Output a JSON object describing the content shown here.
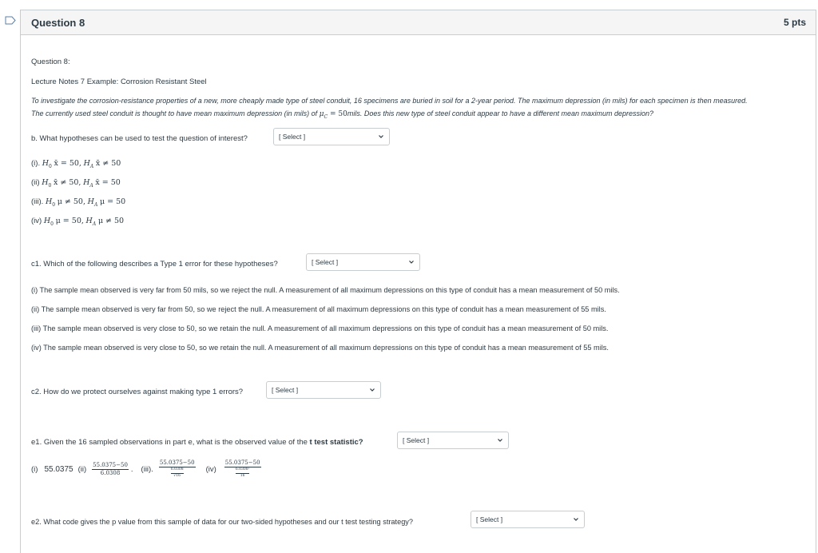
{
  "question": {
    "title": "Question 8",
    "points": "5 pts",
    "label": "Question 8:",
    "subtitle": "Lecture Notes 7 Example: Corrosion Resistant Steel",
    "intro_line1": "To investigate the corrosion-resistance properties of a new, more cheaply made type of steel conduit, 16 specimens are buried in soil for a 2-year period. The maximum depression (in mils) for each specimen is then measured.",
    "intro_line2_pre": "The currently used steel conduit is thought to have mean maximum depression (in mils) of ",
    "intro_math_mu": "μ",
    "intro_math_sub": "C",
    "intro_math_eq": " = 50",
    "intro_line2_post": "mils. Does this new type of steel conduit appear to have a different mean maximum depression?"
  },
  "select_placeholder": "[ Select ]",
  "part_b": {
    "prompt": "b. What hypotheses can be used to test the question of interest?",
    "options": [
      {
        "label": "(i).",
        "h0": "x̄ = 50,",
        "ha": "x̄ ≠ 50"
      },
      {
        "label": "(ii)",
        "h0": "x̄ ≠ 50,",
        "ha": "x̄ = 50"
      },
      {
        "label": "(iii).",
        "h0": "μ ≠ 50,",
        "ha": "μ = 50"
      },
      {
        "label": "(iv)",
        "h0": "μ = 50,",
        "ha": "μ ≠ 50"
      }
    ],
    "h0_symbol": "H",
    "h0_sub": "0",
    "ha_symbol": "H",
    "ha_sub": "A"
  },
  "part_c1": {
    "prompt": "c1. Which of the following describes a Type 1 error for these hypotheses?",
    "options": [
      "(i) The sample mean observed is very far from 50 mils, so we reject the null. A measurement of all maximum depressions on this type of conduit has a mean measurement of 50 mils.",
      "(ii) The sample mean observed is very far from 50, so we reject the null. A measurement of all maximum depressions on this type of conduit has a mean measurement of 55 mils.",
      "(iii) The sample mean observed is very close to 50, so we retain the null. A measurement of all maximum depressions on this type of conduit has a mean measurement of 50 mils.",
      "(iv) The sample mean observed is very close to 50, so we retain the null. A measurement of all maximum depressions on this type of conduit has a mean measurement of 55 mils."
    ]
  },
  "part_c2": {
    "prompt": "c2. How do we protect ourselves against making type 1 errors?"
  },
  "part_e1": {
    "prompt_pre": "e1. Given the 16 sampled observations in part e, what is the observed value of the ",
    "prompt_bold": "t test statistic?",
    "opt_i_label": "(i)",
    "opt_i_value": "55.0375",
    "opt_ii_label": "(ii)",
    "opt_iii_label": "(iii).",
    "opt_iv_label": "(iv)",
    "numerator": "55.0375−50",
    "sd": "6.0308",
    "sd_sq": "6.0308²",
    "n": "16",
    "sqrt_n": "√16"
  },
  "part_e2": {
    "prompt": "e2. What code gives the p value from this sample of data for our two-sided hypotheses and our t test testing strategy?"
  }
}
